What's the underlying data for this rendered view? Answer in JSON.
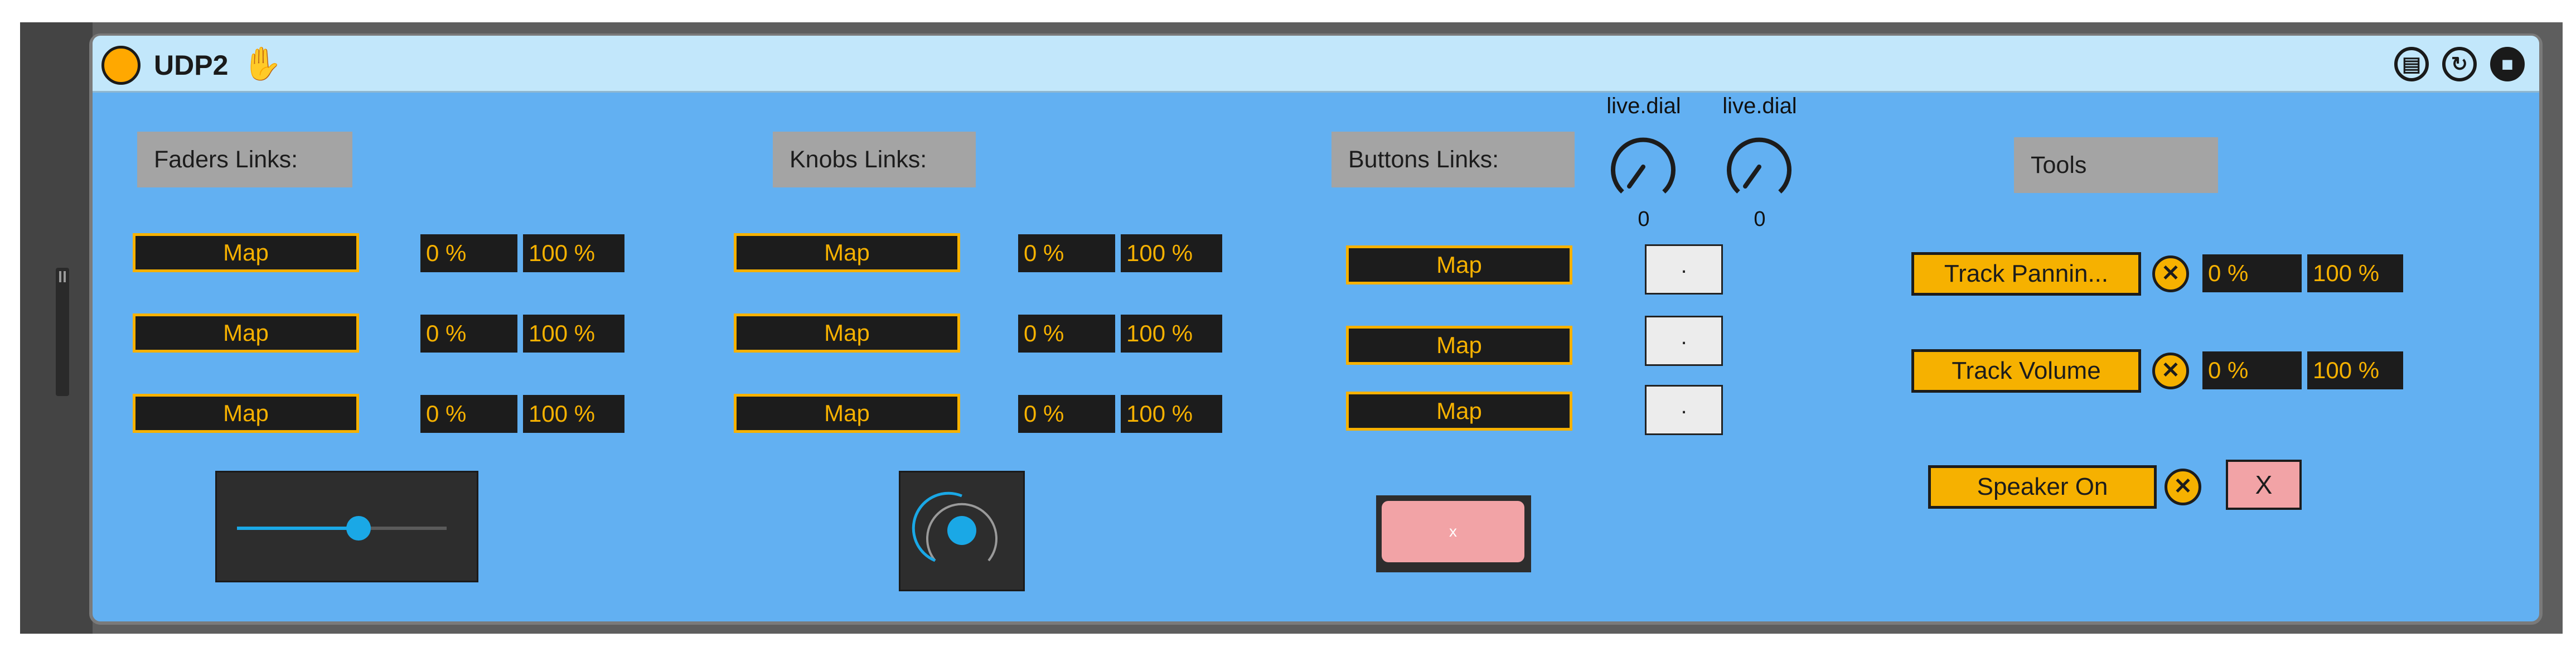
{
  "device": {
    "title": "UDP2"
  },
  "icons": {
    "power": "power-led-icon",
    "hand": "hand-icon",
    "fold": "fold-icon",
    "hot_swap": "hot-swap-icon",
    "save": "save-icon"
  },
  "colors": {
    "panel_bg": "#62b0f2",
    "title_bg": "#c2e7fb",
    "accent": "#f6b100",
    "dark": "#1c1c1c",
    "red_button": "#f2a3a6"
  },
  "faders": {
    "label": "Faders Links:",
    "rows": [
      {
        "map": "Map",
        "min": "0 %",
        "max": "100 %"
      },
      {
        "map": "Map",
        "min": "0 %",
        "max": "100 %"
      },
      {
        "map": "Map",
        "min": "0 %",
        "max": "100 %"
      }
    ],
    "slider_value": 0.58
  },
  "knobs": {
    "label": "Knobs Links:",
    "rows": [
      {
        "map": "Map",
        "min": "0 %",
        "max": "100 %"
      },
      {
        "map": "Map",
        "min": "0 %",
        "max": "100 %"
      },
      {
        "map": "Map",
        "min": "0 %",
        "max": "100 %"
      }
    ]
  },
  "buttons": {
    "label": "Buttons Links:",
    "rows": [
      {
        "map": "Map",
        "toggle": "."
      },
      {
        "map": "Map",
        "toggle": "."
      },
      {
        "map": "Map",
        "toggle": "."
      }
    ],
    "pad_label": "x"
  },
  "dials": [
    {
      "title": "live.dial",
      "value": "0"
    },
    {
      "title": "live.dial",
      "value": "0"
    }
  ],
  "tools": {
    "label": "Tools",
    "track_panning": {
      "label": "Track Pannin...",
      "min": "0 %",
      "max": "100 %"
    },
    "track_volume": {
      "label": "Track Volume",
      "min": "0 %",
      "max": "100 %"
    },
    "speaker": {
      "label": "Speaker On",
      "toggle": "X"
    },
    "remove_symbol": "✕"
  }
}
